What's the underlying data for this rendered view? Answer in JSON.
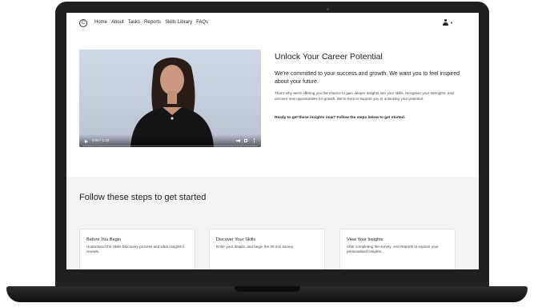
{
  "nav": {
    "logo_letter": "C",
    "links": [
      "Home",
      "About",
      "Tasks",
      "Reports",
      "Skills Library",
      "FAQs"
    ],
    "user_icon": "user-icon"
  },
  "video": {
    "time": "0:00 / 1:10",
    "icons": [
      "play-icon",
      "volume-icon",
      "fullscreen-icon",
      "more-icon"
    ]
  },
  "hero": {
    "title": "Unlock Your Career Potential",
    "lead": "We're committed to your success and growth. We want you to feel inspired about your future.",
    "body": "That's why we're offering you the chance to gain deeper insights into your skills, recognise your strengths, and uncover new opportunities for growth. We're here to support you in unlocking your potential.",
    "cta": "Ready to get these insights now? Follow the steps below to get started."
  },
  "steps": {
    "title": "Follow these steps to get started",
    "cards": [
      {
        "title": "Before You Begin",
        "desc": "Understand the Skills Discovery process and what insights it reveals."
      },
      {
        "title": "Discover Your Skills",
        "desc": "Enter your details, and begin the 30 min survey."
      },
      {
        "title": "View Your Insights",
        "desc": "After completing the survey, visit Reports to explore your personalised insights."
      }
    ]
  },
  "colors": {
    "device_frame": "#1f1f22",
    "steps_background": "#f4f4f4",
    "video_backdrop": "#c8d1df"
  }
}
